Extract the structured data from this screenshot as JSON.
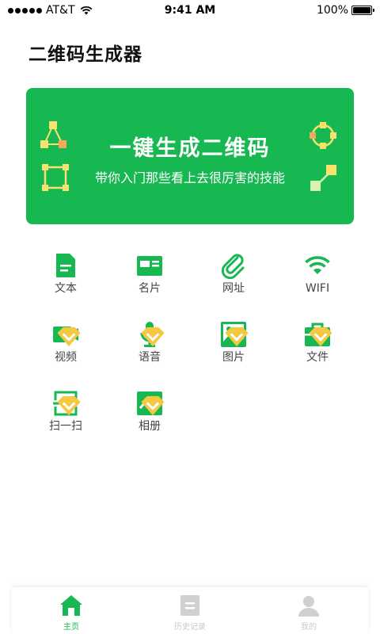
{
  "status_bar": {
    "carrier": "AT&T",
    "time": "9:41 AM",
    "battery": "100%"
  },
  "page_title": "二维码生成器",
  "banner": {
    "title": "一键生成二维码",
    "subtitle": "带你入门那些看上去很厉害的技能"
  },
  "features": [
    {
      "label": "文本",
      "icon": "document-icon",
      "premium": false
    },
    {
      "label": "名片",
      "icon": "business-card-icon",
      "premium": false
    },
    {
      "label": "网址",
      "icon": "paperclip-icon",
      "premium": false
    },
    {
      "label": "WIFI",
      "icon": "wifi-icon",
      "premium": false
    },
    {
      "label": "视频",
      "icon": "video-camera-icon",
      "premium": true
    },
    {
      "label": "语音",
      "icon": "microphone-icon",
      "premium": true
    },
    {
      "label": "图片",
      "icon": "image-icon",
      "premium": true
    },
    {
      "label": "文件",
      "icon": "briefcase-icon",
      "premium": true
    },
    {
      "label": "扫一扫",
      "icon": "scan-icon",
      "premium": true
    },
    {
      "label": "相册",
      "icon": "album-chart-icon",
      "premium": true
    }
  ],
  "tabs": [
    {
      "label": "主页",
      "icon": "home-icon",
      "active": true
    },
    {
      "label": "历史记录",
      "icon": "history-icon",
      "active": false
    },
    {
      "label": "我的",
      "icon": "profile-icon",
      "active": false
    }
  ],
  "colors": {
    "accent": "#17b751",
    "banner_bg": "#17b751",
    "tab_inactive": "#c9c9c9",
    "badge": "#f5c842"
  }
}
